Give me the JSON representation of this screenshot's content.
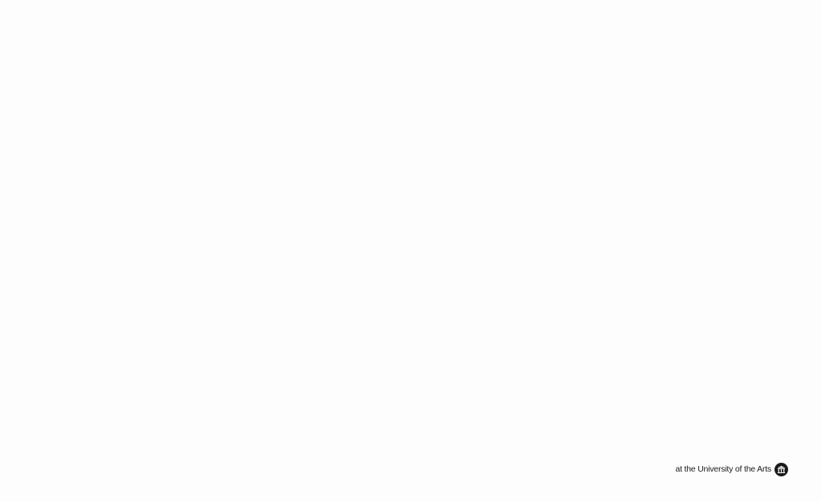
{
  "footer": {
    "affiliation_text": "at the University of the Arts",
    "logo_icon": "building-icon"
  },
  "colors": {
    "background": "#fdfdfd",
    "text": "#1a1a1a"
  }
}
